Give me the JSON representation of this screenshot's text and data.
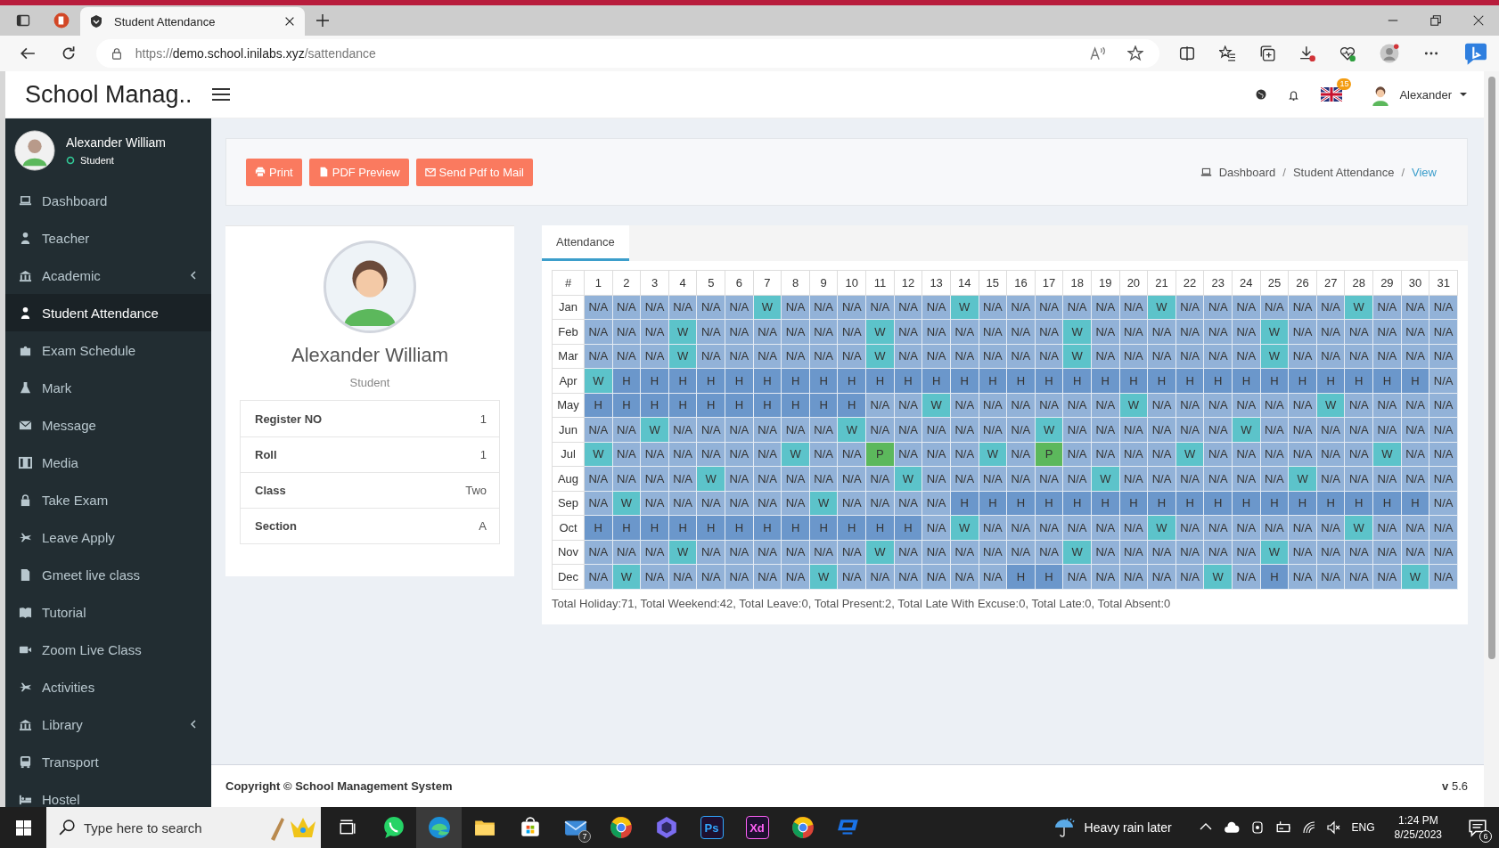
{
  "browser": {
    "tabs": [
      {
        "title": "Student Attendance",
        "selected": true
      }
    ],
    "url": {
      "scheme": "https://",
      "host": "demo.school.inilabs.xyz",
      "path": "/sattendance"
    }
  },
  "header": {
    "brand": "School Manag..",
    "flag_badge": "15",
    "user_name": "Alexander"
  },
  "sidebar": {
    "user_name": "Alexander William",
    "role": "Student",
    "items": [
      {
        "label": "Dashboard",
        "selected": false,
        "expandable": false
      },
      {
        "label": "Teacher",
        "selected": false,
        "expandable": false
      },
      {
        "label": "Academic",
        "selected": false,
        "expandable": true
      },
      {
        "label": "Student Attendance",
        "selected": true,
        "expandable": false
      },
      {
        "label": "Exam Schedule",
        "selected": false,
        "expandable": false
      },
      {
        "label": "Mark",
        "selected": false,
        "expandable": false
      },
      {
        "label": "Message",
        "selected": false,
        "expandable": false
      },
      {
        "label": "Media",
        "selected": false,
        "expandable": false
      },
      {
        "label": "Take Exam",
        "selected": false,
        "expandable": false
      },
      {
        "label": "Leave Apply",
        "selected": false,
        "expandable": false
      },
      {
        "label": "Gmeet live class",
        "selected": false,
        "expandable": false
      },
      {
        "label": "Tutorial",
        "selected": false,
        "expandable": false
      },
      {
        "label": "Zoom Live Class",
        "selected": false,
        "expandable": false
      },
      {
        "label": "Activities",
        "selected": false,
        "expandable": false
      },
      {
        "label": "Library",
        "selected": false,
        "expandable": true
      },
      {
        "label": "Transport",
        "selected": false,
        "expandable": false
      },
      {
        "label": "Hostel",
        "selected": false,
        "expandable": false
      }
    ]
  },
  "toolbar": {
    "buttons": [
      {
        "label": "Print"
      },
      {
        "label": "PDF Preview"
      },
      {
        "label": "Send Pdf to Mail"
      }
    ]
  },
  "breadcrumb": [
    {
      "label": "Dashboard",
      "current": false
    },
    {
      "label": "Student Attendance",
      "current": false,
      "separator": "/"
    },
    {
      "label": "View",
      "current": true,
      "separator": "/"
    }
  ],
  "profile": {
    "name": "Alexander William",
    "role": "Student",
    "fields": [
      {
        "label": "Register NO",
        "value": "1"
      },
      {
        "label": "Roll",
        "value": "1"
      },
      {
        "label": "Class",
        "value": "Two"
      },
      {
        "label": "Section",
        "value": "A"
      }
    ]
  },
  "attendance": {
    "tab": {
      "label": "Attendance",
      "selected": true
    },
    "corner": "#",
    "columns": [
      "1",
      "2",
      "3",
      "4",
      "5",
      "6",
      "7",
      "8",
      "9",
      "10",
      "11",
      "12",
      "13",
      "14",
      "15",
      "16",
      "17",
      "18",
      "19",
      "20",
      "21",
      "22",
      "23",
      "24",
      "25",
      "26",
      "27",
      "28",
      "29",
      "30",
      "31"
    ],
    "rows": [
      {
        "month": "Jan",
        "cells": [
          {
            "text": "N/A",
            "kind": "na"
          },
          {
            "text": "N/A",
            "kind": "na"
          },
          {
            "text": "N/A",
            "kind": "na"
          },
          {
            "text": "N/A",
            "kind": "na"
          },
          {
            "text": "N/A",
            "kind": "na"
          },
          {
            "text": "N/A",
            "kind": "na"
          },
          {
            "text": "W",
            "kind": "weekend"
          },
          {
            "text": "N/A",
            "kind": "na"
          },
          {
            "text": "N/A",
            "kind": "na"
          },
          {
            "text": "N/A",
            "kind": "na"
          },
          {
            "text": "N/A",
            "kind": "na"
          },
          {
            "text": "N/A",
            "kind": "na"
          },
          {
            "text": "N/A",
            "kind": "na"
          },
          {
            "text": "W",
            "kind": "weekend"
          },
          {
            "text": "N/A",
            "kind": "na"
          },
          {
            "text": "N/A",
            "kind": "na"
          },
          {
            "text": "N/A",
            "kind": "na"
          },
          {
            "text": "N/A",
            "kind": "na"
          },
          {
            "text": "N/A",
            "kind": "na"
          },
          {
            "text": "N/A",
            "kind": "na"
          },
          {
            "text": "W",
            "kind": "weekend"
          },
          {
            "text": "N/A",
            "kind": "na"
          },
          {
            "text": "N/A",
            "kind": "na"
          },
          {
            "text": "N/A",
            "kind": "na"
          },
          {
            "text": "N/A",
            "kind": "na"
          },
          {
            "text": "N/A",
            "kind": "na"
          },
          {
            "text": "N/A",
            "kind": "na"
          },
          {
            "text": "W",
            "kind": "weekend"
          },
          {
            "text": "N/A",
            "kind": "na"
          },
          {
            "text": "N/A",
            "kind": "na"
          },
          {
            "text": "N/A",
            "kind": "na"
          }
        ]
      },
      {
        "month": "Feb",
        "cells": [
          {
            "text": "N/A",
            "kind": "na"
          },
          {
            "text": "N/A",
            "kind": "na"
          },
          {
            "text": "N/A",
            "kind": "na"
          },
          {
            "text": "W",
            "kind": "weekend"
          },
          {
            "text": "N/A",
            "kind": "na"
          },
          {
            "text": "N/A",
            "kind": "na"
          },
          {
            "text": "N/A",
            "kind": "na"
          },
          {
            "text": "N/A",
            "kind": "na"
          },
          {
            "text": "N/A",
            "kind": "na"
          },
          {
            "text": "N/A",
            "kind": "na"
          },
          {
            "text": "W",
            "kind": "weekend"
          },
          {
            "text": "N/A",
            "kind": "na"
          },
          {
            "text": "N/A",
            "kind": "na"
          },
          {
            "text": "N/A",
            "kind": "na"
          },
          {
            "text": "N/A",
            "kind": "na"
          },
          {
            "text": "N/A",
            "kind": "na"
          },
          {
            "text": "N/A",
            "kind": "na"
          },
          {
            "text": "W",
            "kind": "weekend"
          },
          {
            "text": "N/A",
            "kind": "na"
          },
          {
            "text": "N/A",
            "kind": "na"
          },
          {
            "text": "N/A",
            "kind": "na"
          },
          {
            "text": "N/A",
            "kind": "na"
          },
          {
            "text": "N/A",
            "kind": "na"
          },
          {
            "text": "N/A",
            "kind": "na"
          },
          {
            "text": "W",
            "kind": "weekend"
          },
          {
            "text": "N/A",
            "kind": "na"
          },
          {
            "text": "N/A",
            "kind": "na"
          },
          {
            "text": "N/A",
            "kind": "na"
          },
          {
            "text": "N/A",
            "kind": "na"
          },
          {
            "text": "N/A",
            "kind": "na"
          },
          {
            "text": "N/A",
            "kind": "na"
          }
        ]
      },
      {
        "month": "Mar",
        "cells": [
          {
            "text": "N/A",
            "kind": "na"
          },
          {
            "text": "N/A",
            "kind": "na"
          },
          {
            "text": "N/A",
            "kind": "na"
          },
          {
            "text": "W",
            "kind": "weekend"
          },
          {
            "text": "N/A",
            "kind": "na"
          },
          {
            "text": "N/A",
            "kind": "na"
          },
          {
            "text": "N/A",
            "kind": "na"
          },
          {
            "text": "N/A",
            "kind": "na"
          },
          {
            "text": "N/A",
            "kind": "na"
          },
          {
            "text": "N/A",
            "kind": "na"
          },
          {
            "text": "W",
            "kind": "weekend"
          },
          {
            "text": "N/A",
            "kind": "na"
          },
          {
            "text": "N/A",
            "kind": "na"
          },
          {
            "text": "N/A",
            "kind": "na"
          },
          {
            "text": "N/A",
            "kind": "na"
          },
          {
            "text": "N/A",
            "kind": "na"
          },
          {
            "text": "N/A",
            "kind": "na"
          },
          {
            "text": "W",
            "kind": "weekend"
          },
          {
            "text": "N/A",
            "kind": "na"
          },
          {
            "text": "N/A",
            "kind": "na"
          },
          {
            "text": "N/A",
            "kind": "na"
          },
          {
            "text": "N/A",
            "kind": "na"
          },
          {
            "text": "N/A",
            "kind": "na"
          },
          {
            "text": "N/A",
            "kind": "na"
          },
          {
            "text": "W",
            "kind": "weekend"
          },
          {
            "text": "N/A",
            "kind": "na"
          },
          {
            "text": "N/A",
            "kind": "na"
          },
          {
            "text": "N/A",
            "kind": "na"
          },
          {
            "text": "N/A",
            "kind": "na"
          },
          {
            "text": "N/A",
            "kind": "na"
          },
          {
            "text": "N/A",
            "kind": "na"
          }
        ]
      },
      {
        "month": "Apr",
        "cells": [
          {
            "text": "W",
            "kind": "weekend"
          },
          {
            "text": "H",
            "kind": "holiday"
          },
          {
            "text": "H",
            "kind": "holiday"
          },
          {
            "text": "H",
            "kind": "holiday"
          },
          {
            "text": "H",
            "kind": "holiday"
          },
          {
            "text": "H",
            "kind": "holiday"
          },
          {
            "text": "H",
            "kind": "holiday"
          },
          {
            "text": "H",
            "kind": "holiday"
          },
          {
            "text": "H",
            "kind": "holiday"
          },
          {
            "text": "H",
            "kind": "holiday"
          },
          {
            "text": "H",
            "kind": "holiday"
          },
          {
            "text": "H",
            "kind": "holiday"
          },
          {
            "text": "H",
            "kind": "holiday"
          },
          {
            "text": "H",
            "kind": "holiday"
          },
          {
            "text": "H",
            "kind": "holiday"
          },
          {
            "text": "H",
            "kind": "holiday"
          },
          {
            "text": "H",
            "kind": "holiday"
          },
          {
            "text": "H",
            "kind": "holiday"
          },
          {
            "text": "H",
            "kind": "holiday"
          },
          {
            "text": "H",
            "kind": "holiday"
          },
          {
            "text": "H",
            "kind": "holiday"
          },
          {
            "text": "H",
            "kind": "holiday"
          },
          {
            "text": "H",
            "kind": "holiday"
          },
          {
            "text": "H",
            "kind": "holiday"
          },
          {
            "text": "H",
            "kind": "holiday"
          },
          {
            "text": "H",
            "kind": "holiday"
          },
          {
            "text": "H",
            "kind": "holiday"
          },
          {
            "text": "H",
            "kind": "holiday"
          },
          {
            "text": "H",
            "kind": "holiday"
          },
          {
            "text": "H",
            "kind": "holiday"
          },
          {
            "text": "N/A",
            "kind": "na"
          }
        ]
      },
      {
        "month": "May",
        "cells": [
          {
            "text": "H",
            "kind": "holiday"
          },
          {
            "text": "H",
            "kind": "holiday"
          },
          {
            "text": "H",
            "kind": "holiday"
          },
          {
            "text": "H",
            "kind": "holiday"
          },
          {
            "text": "H",
            "kind": "holiday"
          },
          {
            "text": "H",
            "kind": "holiday"
          },
          {
            "text": "H",
            "kind": "holiday"
          },
          {
            "text": "H",
            "kind": "holiday"
          },
          {
            "text": "H",
            "kind": "holiday"
          },
          {
            "text": "H",
            "kind": "holiday"
          },
          {
            "text": "N/A",
            "kind": "na"
          },
          {
            "text": "N/A",
            "kind": "na"
          },
          {
            "text": "W",
            "kind": "weekend"
          },
          {
            "text": "N/A",
            "kind": "na"
          },
          {
            "text": "N/A",
            "kind": "na"
          },
          {
            "text": "N/A",
            "kind": "na"
          },
          {
            "text": "N/A",
            "kind": "na"
          },
          {
            "text": "N/A",
            "kind": "na"
          },
          {
            "text": "N/A",
            "kind": "na"
          },
          {
            "text": "W",
            "kind": "weekend"
          },
          {
            "text": "N/A",
            "kind": "na"
          },
          {
            "text": "N/A",
            "kind": "na"
          },
          {
            "text": "N/A",
            "kind": "na"
          },
          {
            "text": "N/A",
            "kind": "na"
          },
          {
            "text": "N/A",
            "kind": "na"
          },
          {
            "text": "N/A",
            "kind": "na"
          },
          {
            "text": "W",
            "kind": "weekend"
          },
          {
            "text": "N/A",
            "kind": "na"
          },
          {
            "text": "N/A",
            "kind": "na"
          },
          {
            "text": "N/A",
            "kind": "na"
          },
          {
            "text": "N/A",
            "kind": "na"
          }
        ]
      },
      {
        "month": "Jun",
        "cells": [
          {
            "text": "N/A",
            "kind": "na"
          },
          {
            "text": "N/A",
            "kind": "na"
          },
          {
            "text": "W",
            "kind": "weekend"
          },
          {
            "text": "N/A",
            "kind": "na"
          },
          {
            "text": "N/A",
            "kind": "na"
          },
          {
            "text": "N/A",
            "kind": "na"
          },
          {
            "text": "N/A",
            "kind": "na"
          },
          {
            "text": "N/A",
            "kind": "na"
          },
          {
            "text": "N/A",
            "kind": "na"
          },
          {
            "text": "W",
            "kind": "weekend"
          },
          {
            "text": "N/A",
            "kind": "na"
          },
          {
            "text": "N/A",
            "kind": "na"
          },
          {
            "text": "N/A",
            "kind": "na"
          },
          {
            "text": "N/A",
            "kind": "na"
          },
          {
            "text": "N/A",
            "kind": "na"
          },
          {
            "text": "N/A",
            "kind": "na"
          },
          {
            "text": "W",
            "kind": "weekend"
          },
          {
            "text": "N/A",
            "kind": "na"
          },
          {
            "text": "N/A",
            "kind": "na"
          },
          {
            "text": "N/A",
            "kind": "na"
          },
          {
            "text": "N/A",
            "kind": "na"
          },
          {
            "text": "N/A",
            "kind": "na"
          },
          {
            "text": "N/A",
            "kind": "na"
          },
          {
            "text": "W",
            "kind": "weekend"
          },
          {
            "text": "N/A",
            "kind": "na"
          },
          {
            "text": "N/A",
            "kind": "na"
          },
          {
            "text": "N/A",
            "kind": "na"
          },
          {
            "text": "N/A",
            "kind": "na"
          },
          {
            "text": "N/A",
            "kind": "na"
          },
          {
            "text": "N/A",
            "kind": "na"
          },
          {
            "text": "N/A",
            "kind": "na"
          }
        ]
      },
      {
        "month": "Jul",
        "cells": [
          {
            "text": "W",
            "kind": "weekend"
          },
          {
            "text": "N/A",
            "kind": "na"
          },
          {
            "text": "N/A",
            "kind": "na"
          },
          {
            "text": "N/A",
            "kind": "na"
          },
          {
            "text": "N/A",
            "kind": "na"
          },
          {
            "text": "N/A",
            "kind": "na"
          },
          {
            "text": "N/A",
            "kind": "na"
          },
          {
            "text": "W",
            "kind": "weekend"
          },
          {
            "text": "N/A",
            "kind": "na"
          },
          {
            "text": "N/A",
            "kind": "na"
          },
          {
            "text": "P",
            "kind": "present"
          },
          {
            "text": "N/A",
            "kind": "na"
          },
          {
            "text": "N/A",
            "kind": "na"
          },
          {
            "text": "N/A",
            "kind": "na"
          },
          {
            "text": "W",
            "kind": "weekend"
          },
          {
            "text": "N/A",
            "kind": "na"
          },
          {
            "text": "P",
            "kind": "present"
          },
          {
            "text": "N/A",
            "kind": "na"
          },
          {
            "text": "N/A",
            "kind": "na"
          },
          {
            "text": "N/A",
            "kind": "na"
          },
          {
            "text": "N/A",
            "kind": "na"
          },
          {
            "text": "W",
            "kind": "weekend"
          },
          {
            "text": "N/A",
            "kind": "na"
          },
          {
            "text": "N/A",
            "kind": "na"
          },
          {
            "text": "N/A",
            "kind": "na"
          },
          {
            "text": "N/A",
            "kind": "na"
          },
          {
            "text": "N/A",
            "kind": "na"
          },
          {
            "text": "N/A",
            "kind": "na"
          },
          {
            "text": "W",
            "kind": "weekend"
          },
          {
            "text": "N/A",
            "kind": "na"
          },
          {
            "text": "N/A",
            "kind": "na"
          }
        ]
      },
      {
        "month": "Aug",
        "cells": [
          {
            "text": "N/A",
            "kind": "na"
          },
          {
            "text": "N/A",
            "kind": "na"
          },
          {
            "text": "N/A",
            "kind": "na"
          },
          {
            "text": "N/A",
            "kind": "na"
          },
          {
            "text": "W",
            "kind": "weekend"
          },
          {
            "text": "N/A",
            "kind": "na"
          },
          {
            "text": "N/A",
            "kind": "na"
          },
          {
            "text": "N/A",
            "kind": "na"
          },
          {
            "text": "N/A",
            "kind": "na"
          },
          {
            "text": "N/A",
            "kind": "na"
          },
          {
            "text": "N/A",
            "kind": "na"
          },
          {
            "text": "W",
            "kind": "weekend"
          },
          {
            "text": "N/A",
            "kind": "na"
          },
          {
            "text": "N/A",
            "kind": "na"
          },
          {
            "text": "N/A",
            "kind": "na"
          },
          {
            "text": "N/A",
            "kind": "na"
          },
          {
            "text": "N/A",
            "kind": "na"
          },
          {
            "text": "N/A",
            "kind": "na"
          },
          {
            "text": "W",
            "kind": "weekend"
          },
          {
            "text": "N/A",
            "kind": "na"
          },
          {
            "text": "N/A",
            "kind": "na"
          },
          {
            "text": "N/A",
            "kind": "na"
          },
          {
            "text": "N/A",
            "kind": "na"
          },
          {
            "text": "N/A",
            "kind": "na"
          },
          {
            "text": "N/A",
            "kind": "na"
          },
          {
            "text": "W",
            "kind": "weekend"
          },
          {
            "text": "N/A",
            "kind": "na"
          },
          {
            "text": "N/A",
            "kind": "na"
          },
          {
            "text": "N/A",
            "kind": "na"
          },
          {
            "text": "N/A",
            "kind": "na"
          },
          {
            "text": "N/A",
            "kind": "na"
          }
        ]
      },
      {
        "month": "Sep",
        "cells": [
          {
            "text": "N/A",
            "kind": "na"
          },
          {
            "text": "W",
            "kind": "weekend"
          },
          {
            "text": "N/A",
            "kind": "na"
          },
          {
            "text": "N/A",
            "kind": "na"
          },
          {
            "text": "N/A",
            "kind": "na"
          },
          {
            "text": "N/A",
            "kind": "na"
          },
          {
            "text": "N/A",
            "kind": "na"
          },
          {
            "text": "N/A",
            "kind": "na"
          },
          {
            "text": "W",
            "kind": "weekend"
          },
          {
            "text": "N/A",
            "kind": "na"
          },
          {
            "text": "N/A",
            "kind": "na"
          },
          {
            "text": "N/A",
            "kind": "na"
          },
          {
            "text": "N/A",
            "kind": "na"
          },
          {
            "text": "H",
            "kind": "holiday"
          },
          {
            "text": "H",
            "kind": "holiday"
          },
          {
            "text": "H",
            "kind": "holiday"
          },
          {
            "text": "H",
            "kind": "holiday"
          },
          {
            "text": "H",
            "kind": "holiday"
          },
          {
            "text": "H",
            "kind": "holiday"
          },
          {
            "text": "H",
            "kind": "holiday"
          },
          {
            "text": "H",
            "kind": "holiday"
          },
          {
            "text": "H",
            "kind": "holiday"
          },
          {
            "text": "H",
            "kind": "holiday"
          },
          {
            "text": "H",
            "kind": "holiday"
          },
          {
            "text": "H",
            "kind": "holiday"
          },
          {
            "text": "H",
            "kind": "holiday"
          },
          {
            "text": "H",
            "kind": "holiday"
          },
          {
            "text": "H",
            "kind": "holiday"
          },
          {
            "text": "H",
            "kind": "holiday"
          },
          {
            "text": "H",
            "kind": "holiday"
          },
          {
            "text": "N/A",
            "kind": "na"
          }
        ]
      },
      {
        "month": "Oct",
        "cells": [
          {
            "text": "H",
            "kind": "holiday"
          },
          {
            "text": "H",
            "kind": "holiday"
          },
          {
            "text": "H",
            "kind": "holiday"
          },
          {
            "text": "H",
            "kind": "holiday"
          },
          {
            "text": "H",
            "kind": "holiday"
          },
          {
            "text": "H",
            "kind": "holiday"
          },
          {
            "text": "H",
            "kind": "holiday"
          },
          {
            "text": "H",
            "kind": "holiday"
          },
          {
            "text": "H",
            "kind": "holiday"
          },
          {
            "text": "H",
            "kind": "holiday"
          },
          {
            "text": "H",
            "kind": "holiday"
          },
          {
            "text": "H",
            "kind": "holiday"
          },
          {
            "text": "N/A",
            "kind": "na"
          },
          {
            "text": "W",
            "kind": "weekend"
          },
          {
            "text": "N/A",
            "kind": "na"
          },
          {
            "text": "N/A",
            "kind": "na"
          },
          {
            "text": "N/A",
            "kind": "na"
          },
          {
            "text": "N/A",
            "kind": "na"
          },
          {
            "text": "N/A",
            "kind": "na"
          },
          {
            "text": "N/A",
            "kind": "na"
          },
          {
            "text": "W",
            "kind": "weekend"
          },
          {
            "text": "N/A",
            "kind": "na"
          },
          {
            "text": "N/A",
            "kind": "na"
          },
          {
            "text": "N/A",
            "kind": "na"
          },
          {
            "text": "N/A",
            "kind": "na"
          },
          {
            "text": "N/A",
            "kind": "na"
          },
          {
            "text": "N/A",
            "kind": "na"
          },
          {
            "text": "W",
            "kind": "weekend"
          },
          {
            "text": "N/A",
            "kind": "na"
          },
          {
            "text": "N/A",
            "kind": "na"
          },
          {
            "text": "N/A",
            "kind": "na"
          }
        ]
      },
      {
        "month": "Nov",
        "cells": [
          {
            "text": "N/A",
            "kind": "na"
          },
          {
            "text": "N/A",
            "kind": "na"
          },
          {
            "text": "N/A",
            "kind": "na"
          },
          {
            "text": "W",
            "kind": "weekend"
          },
          {
            "text": "N/A",
            "kind": "na"
          },
          {
            "text": "N/A",
            "kind": "na"
          },
          {
            "text": "N/A",
            "kind": "na"
          },
          {
            "text": "N/A",
            "kind": "na"
          },
          {
            "text": "N/A",
            "kind": "na"
          },
          {
            "text": "N/A",
            "kind": "na"
          },
          {
            "text": "W",
            "kind": "weekend"
          },
          {
            "text": "N/A",
            "kind": "na"
          },
          {
            "text": "N/A",
            "kind": "na"
          },
          {
            "text": "N/A",
            "kind": "na"
          },
          {
            "text": "N/A",
            "kind": "na"
          },
          {
            "text": "N/A",
            "kind": "na"
          },
          {
            "text": "N/A",
            "kind": "na"
          },
          {
            "text": "W",
            "kind": "weekend"
          },
          {
            "text": "N/A",
            "kind": "na"
          },
          {
            "text": "N/A",
            "kind": "na"
          },
          {
            "text": "N/A",
            "kind": "na"
          },
          {
            "text": "N/A",
            "kind": "na"
          },
          {
            "text": "N/A",
            "kind": "na"
          },
          {
            "text": "N/A",
            "kind": "na"
          },
          {
            "text": "W",
            "kind": "weekend"
          },
          {
            "text": "N/A",
            "kind": "na"
          },
          {
            "text": "N/A",
            "kind": "na"
          },
          {
            "text": "N/A",
            "kind": "na"
          },
          {
            "text": "N/A",
            "kind": "na"
          },
          {
            "text": "N/A",
            "kind": "na"
          },
          {
            "text": "N/A",
            "kind": "na"
          }
        ]
      },
      {
        "month": "Dec",
        "cells": [
          {
            "text": "N/A",
            "kind": "na"
          },
          {
            "text": "W",
            "kind": "weekend"
          },
          {
            "text": "N/A",
            "kind": "na"
          },
          {
            "text": "N/A",
            "kind": "na"
          },
          {
            "text": "N/A",
            "kind": "na"
          },
          {
            "text": "N/A",
            "kind": "na"
          },
          {
            "text": "N/A",
            "kind": "na"
          },
          {
            "text": "N/A",
            "kind": "na"
          },
          {
            "text": "W",
            "kind": "weekend"
          },
          {
            "text": "N/A",
            "kind": "na"
          },
          {
            "text": "N/A",
            "kind": "na"
          },
          {
            "text": "N/A",
            "kind": "na"
          },
          {
            "text": "N/A",
            "kind": "na"
          },
          {
            "text": "N/A",
            "kind": "na"
          },
          {
            "text": "N/A",
            "kind": "na"
          },
          {
            "text": "H",
            "kind": "holiday"
          },
          {
            "text": "H",
            "kind": "holiday"
          },
          {
            "text": "N/A",
            "kind": "na"
          },
          {
            "text": "N/A",
            "kind": "na"
          },
          {
            "text": "N/A",
            "kind": "na"
          },
          {
            "text": "N/A",
            "kind": "na"
          },
          {
            "text": "N/A",
            "kind": "na"
          },
          {
            "text": "W",
            "kind": "weekend"
          },
          {
            "text": "N/A",
            "kind": "na"
          },
          {
            "text": "H",
            "kind": "holiday"
          },
          {
            "text": "N/A",
            "kind": "na"
          },
          {
            "text": "N/A",
            "kind": "na"
          },
          {
            "text": "N/A",
            "kind": "na"
          },
          {
            "text": "N/A",
            "kind": "na"
          },
          {
            "text": "W",
            "kind": "weekend"
          },
          {
            "text": "N/A",
            "kind": "na"
          }
        ]
      }
    ],
    "summary": "Total Holiday:71, Total Weekend:42, Total Leave:0, Total Present:2, Total Late With Excuse:0, Total Late:0, Total Absent:0"
  },
  "footer": {
    "copyright": "Copyright © School Management System",
    "version": "**v** 5.6"
  },
  "taskbar": {
    "search_placeholder": "Type here to search",
    "apps": [
      {
        "kind": "chat",
        "selected": false
      },
      {
        "kind": "browser",
        "selected": true
      },
      {
        "kind": "folder",
        "selected": false
      },
      {
        "kind": "store",
        "selected": false
      },
      {
        "kind": "mail",
        "selected": false,
        "badge": "7"
      },
      {
        "kind": "round",
        "selected": false
      },
      {
        "kind": "hexagon",
        "selected": false
      },
      {
        "kind": "tile",
        "selected": false,
        "label": "Ps",
        "color": "#31a8ff"
      },
      {
        "kind": "tile",
        "selected": false,
        "label": "Xd",
        "color": "#ff61f6"
      },
      {
        "kind": "round",
        "selected": false
      },
      {
        "kind": "remote",
        "selected": false
      }
    ],
    "weather": "Heavy rain later",
    "language": "ENG",
    "time": "1:24 PM",
    "date": "8/25/2023",
    "notification_badge": "6"
  }
}
